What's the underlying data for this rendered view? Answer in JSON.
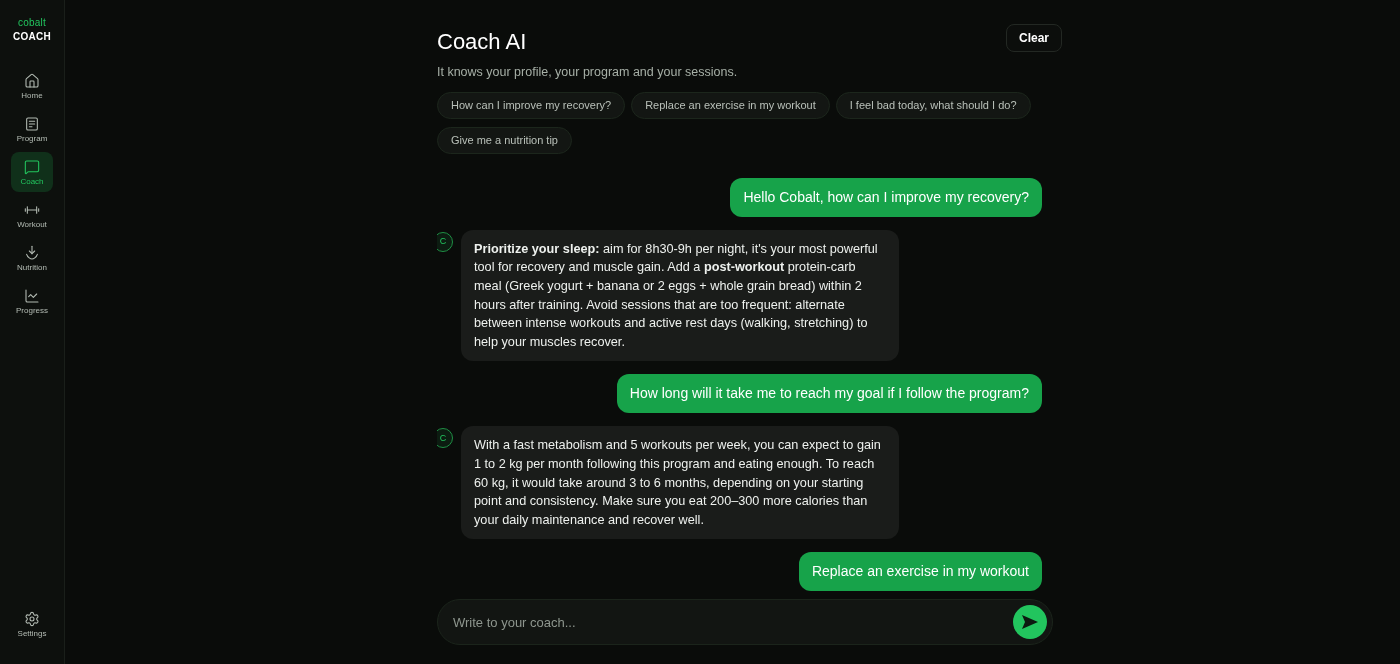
{
  "sidebar": {
    "logo": {
      "top": "cobalt",
      "bottom": "COACH"
    },
    "items": [
      {
        "label": "Home",
        "selected": false
      },
      {
        "label": "Program",
        "selected": false
      },
      {
        "label": "Coach",
        "selected": true
      },
      {
        "label": "Workout",
        "selected": false
      },
      {
        "label": "Nutrition",
        "selected": false
      },
      {
        "label": "Progress",
        "selected": false
      }
    ],
    "footer_item": {
      "label": "Settings",
      "selected": false
    }
  },
  "header": {
    "title": "Coach AI",
    "subtitle": "It knows your profile, your program and your sessions.",
    "clear_button": "Clear"
  },
  "suggestions": [
    "How can I improve my recovery?",
    "Replace an exercise in my workout",
    "I feel bad today, what should I do?",
    "Give me a nutrition tip"
  ],
  "messages": [
    {
      "kind": "user",
      "text": "Hello Cobalt, how can I improve my recovery?"
    },
    {
      "kind": "coach",
      "avatar": "C",
      "text": "**Prioritize your sleep:** aim for 8h30-9h per night, it's your most powerful tool for recovery and muscle gain. Add a **post-workout** protein-carb meal (Greek yogurt + banana or 2 eggs + whole grain bread) within 2 hours after training. Avoid sessions that are too frequent: alternate between intense workouts and active rest days (walking, stretching) to help your muscles recover."
    },
    {
      "kind": "user",
      "text": "How long will it take me to reach my goal if I follow the program?"
    },
    {
      "kind": "coach",
      "avatar": "C",
      "text": "With a fast metabolism and 5 workouts per week, you can expect to gain 1 to 2 kg per month following this program and eating enough. To reach 60 kg, it would take around 3 to 6 months, depending on your starting point and consistency. Make sure you eat 200–300 more calories than your daily maintenance and recover well."
    },
    {
      "kind": "user",
      "text": "Replace an exercise in my workout"
    }
  ],
  "composer": {
    "placeholder": "Write to your coach..."
  }
}
